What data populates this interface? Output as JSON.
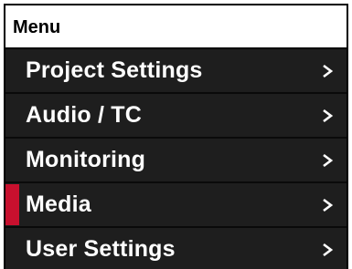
{
  "menu": {
    "title": "Menu",
    "items": [
      {
        "label": "Project Settings",
        "selected": false,
        "icon": "chevron-right-icon"
      },
      {
        "label": "Audio / TC",
        "selected": false,
        "icon": "chevron-right-icon"
      },
      {
        "label": "Monitoring",
        "selected": false,
        "icon": "chevron-right-icon"
      },
      {
        "label": "Media",
        "selected": true,
        "icon": "chevron-right-icon"
      },
      {
        "label": "User Settings",
        "selected": false,
        "icon": "chevron-right-icon"
      }
    ]
  },
  "colors": {
    "background": "#1e1e1e",
    "header_background": "#ffffff",
    "text": "#ffffff",
    "selection_indicator": "#c8102e"
  }
}
